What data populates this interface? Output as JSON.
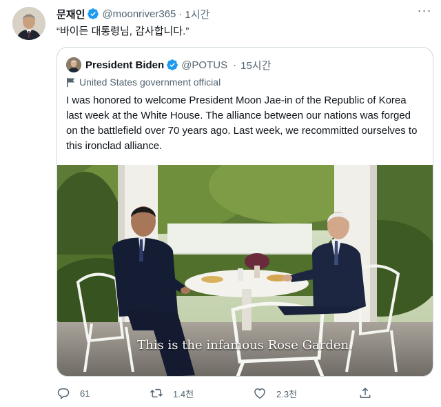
{
  "tweet": {
    "author_name": "문재인",
    "author_handle": "@moonriver365",
    "separator": "·",
    "time": "1시간",
    "more_icon": "more-horizontal-icon",
    "text": "“바이든 대통령님, 감사합니다.”"
  },
  "quoted": {
    "author_name": "President Biden",
    "author_handle": "@POTUS",
    "separator": "·",
    "time": "15시간",
    "label": "United States government official",
    "text": "I was honored to welcome President Moon Jae-in of the Republic of Korea last week at the White House. The alliance between our nations was forged on the battlefield over 70 years ago. Last week, we recommitted ourselves to this ironclad alliance.",
    "media_caption": "This is the infamous Rose Garden."
  },
  "actions": {
    "reply_count": "61",
    "retweet_count": "1.4천",
    "like_count": "2.3천",
    "share_icon": "share-icon"
  },
  "colors": {
    "text": "#0f1419",
    "secondary": "#536471",
    "verified": "#1d9bf0",
    "border": "#cfd9de"
  }
}
